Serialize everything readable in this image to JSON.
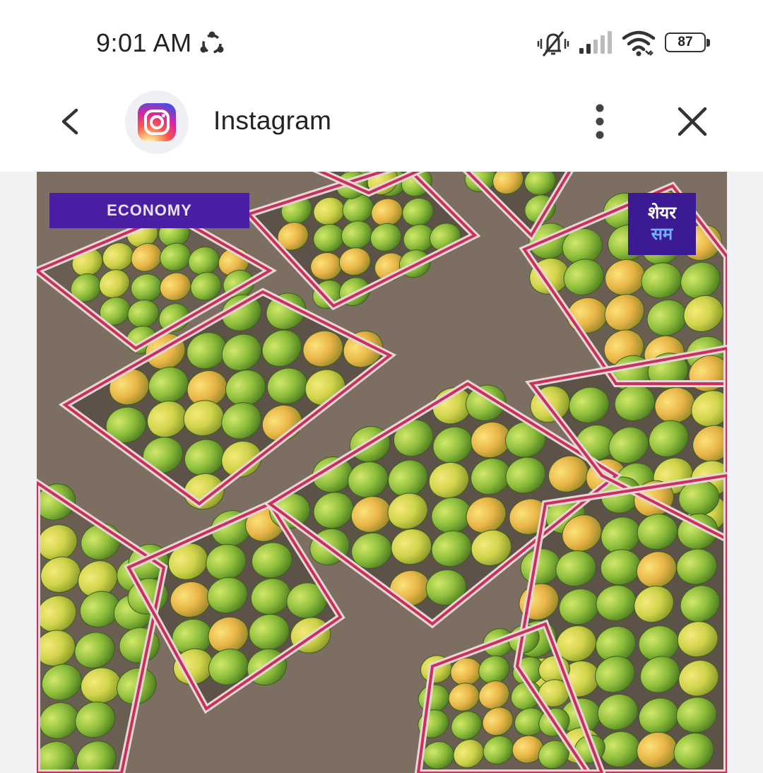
{
  "status_bar": {
    "time": "9:01 AM",
    "battery_level": "87",
    "icons": [
      "sync-icon",
      "mute-icon",
      "signal-icon",
      "wifi-icon",
      "battery-icon"
    ]
  },
  "header": {
    "title": "Instagram",
    "icons": [
      "chevron-left-icon",
      "instagram-logo",
      "more-vertical-icon",
      "close-icon"
    ]
  },
  "post": {
    "tag": "ECONOMY",
    "brand_line1": "शेयर",
    "brand_line2": "सम"
  },
  "colors": {
    "tag_bg": "#4b1fa3",
    "brand_bg": "#3c1a93",
    "content_bg": "#f1f2f4"
  }
}
